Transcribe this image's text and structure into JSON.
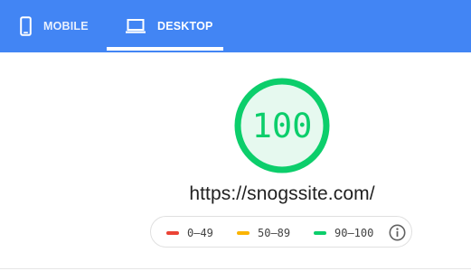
{
  "tabs": [
    {
      "label": "MOBILE",
      "icon": "phone-icon",
      "active": false
    },
    {
      "label": "DESKTOP",
      "icon": "laptop-icon",
      "active": true
    }
  ],
  "report": {
    "score": "100",
    "url": "https://snogssite.com/"
  },
  "legend": {
    "items": [
      {
        "range": "0–49",
        "color": "#eb4335"
      },
      {
        "range": "50–89",
        "color": "#fbb400"
      },
      {
        "range": "90–100",
        "color": "#0cce6b"
      }
    ],
    "info_icon": "info-icon"
  },
  "colors": {
    "tabbar": "#4285f4",
    "pass": "#0cce6b",
    "pass_fill": "#e6f9ef"
  }
}
